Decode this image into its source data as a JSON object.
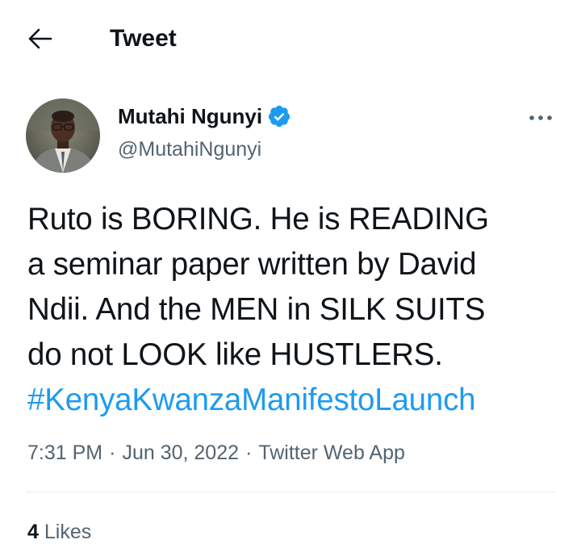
{
  "header": {
    "title": "Tweet",
    "back_icon": "arrow-left-icon"
  },
  "tweet": {
    "author": {
      "name": "Mutahi Ngunyi",
      "handle": "@MutahiNgunyi",
      "verified": true,
      "verified_icon": "verified-badge-icon"
    },
    "more_icon": "more-horizontal-icon",
    "text_lines": [
      "Ruto is BORING. He is READING",
      "a seminar paper written by David",
      "Ndii. And the MEN in SILK SUITS",
      "do not LOOK like HUSTLERS."
    ],
    "hashtag": "#KenyaKwanzaManifestoLaunch",
    "time": "7:31 PM",
    "date": "Jun 30, 2022",
    "separator": "·",
    "source": "Twitter Web App"
  },
  "stats": {
    "likes_count": "4",
    "likes_label": "Likes"
  },
  "colors": {
    "text": "#0f1419",
    "secondary": "#536471",
    "accent": "#1d9bf0",
    "divider": "#e6ecf0"
  }
}
